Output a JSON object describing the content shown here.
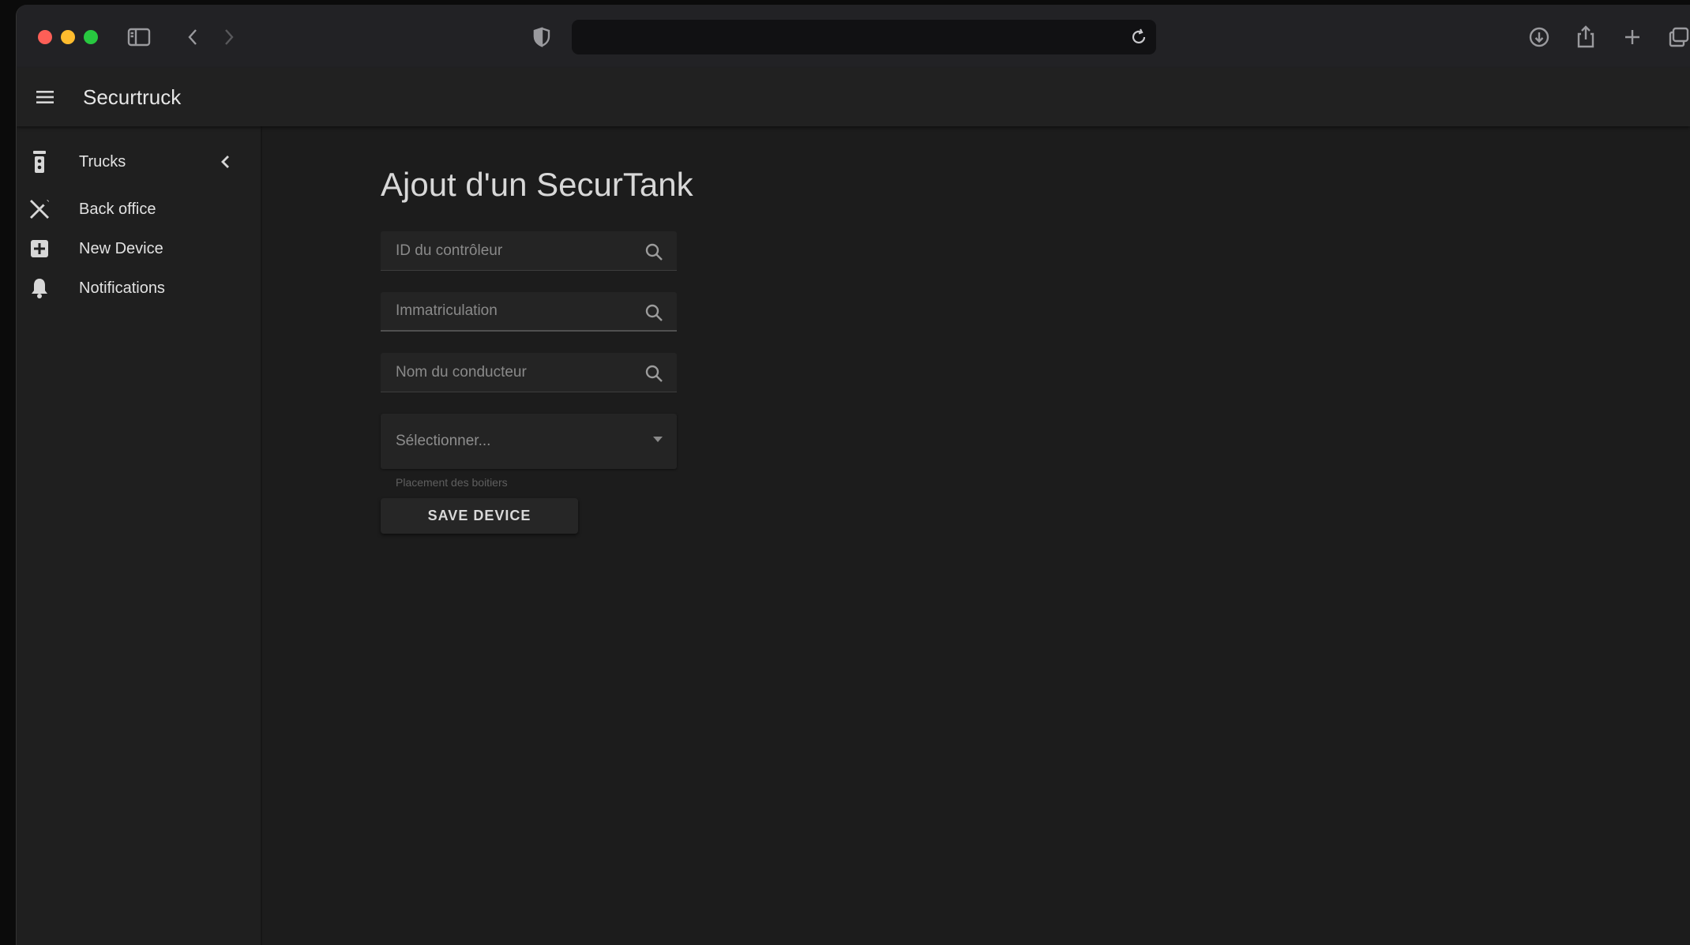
{
  "browser": {
    "url": "",
    "traffic_lights": {
      "close": "#fe5f57",
      "minimize": "#febc2e",
      "zoom": "#28c840"
    },
    "icons": [
      "sidebar-toggle-icon",
      "back-icon",
      "forward-icon",
      "shield-icon",
      "reload-icon",
      "download-icon",
      "share-icon",
      "new-tab-icon",
      "tabs-overview-icon"
    ]
  },
  "app": {
    "title": "Securtruck"
  },
  "sidebar": {
    "items": [
      {
        "label": "Trucks",
        "icon": "traffic-light-icon",
        "has_chevron": true
      },
      {
        "label": "Back office",
        "icon": "tools-icon"
      },
      {
        "label": "New Device",
        "icon": "plus-box-icon"
      },
      {
        "label": "Notifications",
        "icon": "bell-icon"
      }
    ]
  },
  "main": {
    "title": "Ajout d'un SecurTank",
    "fields": [
      {
        "placeholder": "ID du contrôleur",
        "value": ""
      },
      {
        "placeholder": "Immatriculation",
        "value": ""
      },
      {
        "placeholder": "Nom du conducteur",
        "value": ""
      }
    ],
    "select": {
      "value": "Sélectionner...",
      "helper": "Placement des boitiers"
    },
    "save_label": "SAVE DEVICE"
  },
  "colors": {
    "background": "#1c1c1c",
    "appbar": "#212121",
    "sidebar": "#1f1f1f",
    "text": "#e2e2e2"
  }
}
